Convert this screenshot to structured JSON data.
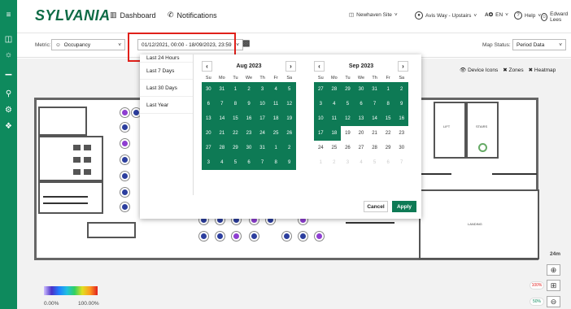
{
  "app": {
    "logo": "SYLVANIA"
  },
  "nav": {
    "dashboard": "Dashboard",
    "notifications": "Notifications"
  },
  "top_right": {
    "site": "Newhaven Site",
    "location": "Avis Way - Upstairs",
    "language": "EN",
    "help": "Help",
    "user": "Edward Lees"
  },
  "filters": {
    "metric_label": "Metric:",
    "metric_value": "Occupancy",
    "date_range": "01/12/2021, 00:00 - 18/09/2023, 23:59",
    "map_status_label": "Map Status:",
    "map_status_value": "Period Data"
  },
  "view_options": {
    "device_icons": "Device Icons",
    "zones": "Zones",
    "heatmap": "Heatmap"
  },
  "datepicker": {
    "presets": [
      "Last 24 Hours",
      "Last 7 Days",
      "Last 30 Days",
      "Last Year"
    ],
    "weekdays": [
      "Su",
      "Mo",
      "Tu",
      "We",
      "Th",
      "Fr",
      "Sa"
    ],
    "months": [
      {
        "title": "Aug 2023",
        "days": [
          {
            "d": "30",
            "s": "sel"
          },
          {
            "d": "31",
            "s": "sel"
          },
          {
            "d": "1",
            "s": "sel"
          },
          {
            "d": "2",
            "s": "sel"
          },
          {
            "d": "3",
            "s": "sel"
          },
          {
            "d": "4",
            "s": "sel"
          },
          {
            "d": "5",
            "s": "sel"
          },
          {
            "d": "6",
            "s": "sel"
          },
          {
            "d": "7",
            "s": "sel"
          },
          {
            "d": "8",
            "s": "sel"
          },
          {
            "d": "9",
            "s": "sel"
          },
          {
            "d": "10",
            "s": "sel"
          },
          {
            "d": "11",
            "s": "sel"
          },
          {
            "d": "12",
            "s": "sel"
          },
          {
            "d": "13",
            "s": "sel"
          },
          {
            "d": "14",
            "s": "sel"
          },
          {
            "d": "15",
            "s": "sel"
          },
          {
            "d": "16",
            "s": "sel"
          },
          {
            "d": "17",
            "s": "sel"
          },
          {
            "d": "18",
            "s": "sel"
          },
          {
            "d": "19",
            "s": "sel"
          },
          {
            "d": "20",
            "s": "sel"
          },
          {
            "d": "21",
            "s": "sel"
          },
          {
            "d": "22",
            "s": "sel"
          },
          {
            "d": "23",
            "s": "sel"
          },
          {
            "d": "24",
            "s": "sel"
          },
          {
            "d": "25",
            "s": "sel"
          },
          {
            "d": "26",
            "s": "sel"
          },
          {
            "d": "27",
            "s": "sel"
          },
          {
            "d": "28",
            "s": "sel"
          },
          {
            "d": "29",
            "s": "sel"
          },
          {
            "d": "30",
            "s": "sel"
          },
          {
            "d": "31",
            "s": "sel"
          },
          {
            "d": "1",
            "s": "sel"
          },
          {
            "d": "2",
            "s": "sel"
          },
          {
            "d": "3",
            "s": "sel"
          },
          {
            "d": "4",
            "s": "sel"
          },
          {
            "d": "5",
            "s": "sel"
          },
          {
            "d": "6",
            "s": "sel"
          },
          {
            "d": "7",
            "s": "sel"
          },
          {
            "d": "8",
            "s": "sel"
          },
          {
            "d": "9",
            "s": "sel"
          }
        ]
      },
      {
        "title": "Sep 2023",
        "days": [
          {
            "d": "27",
            "s": "sel"
          },
          {
            "d": "28",
            "s": "sel"
          },
          {
            "d": "29",
            "s": "sel"
          },
          {
            "d": "30",
            "s": "sel"
          },
          {
            "d": "31",
            "s": "sel"
          },
          {
            "d": "1",
            "s": "sel"
          },
          {
            "d": "2",
            "s": "sel"
          },
          {
            "d": "3",
            "s": "sel"
          },
          {
            "d": "4",
            "s": "sel"
          },
          {
            "d": "5",
            "s": "sel"
          },
          {
            "d": "6",
            "s": "sel"
          },
          {
            "d": "7",
            "s": "sel"
          },
          {
            "d": "8",
            "s": "sel"
          },
          {
            "d": "9",
            "s": "sel"
          },
          {
            "d": "10",
            "s": "sel"
          },
          {
            "d": "11",
            "s": "sel"
          },
          {
            "d": "12",
            "s": "sel"
          },
          {
            "d": "13",
            "s": "sel"
          },
          {
            "d": "14",
            "s": "sel"
          },
          {
            "d": "15",
            "s": "sel"
          },
          {
            "d": "16",
            "s": "sel"
          },
          {
            "d": "17",
            "s": "sel"
          },
          {
            "d": "18",
            "s": "sel"
          },
          {
            "d": "19",
            "s": ""
          },
          {
            "d": "20",
            "s": ""
          },
          {
            "d": "21",
            "s": ""
          },
          {
            "d": "22",
            "s": ""
          },
          {
            "d": "23",
            "s": ""
          },
          {
            "d": "24",
            "s": ""
          },
          {
            "d": "25",
            "s": ""
          },
          {
            "d": "26",
            "s": ""
          },
          {
            "d": "27",
            "s": ""
          },
          {
            "d": "28",
            "s": ""
          },
          {
            "d": "29",
            "s": ""
          },
          {
            "d": "30",
            "s": ""
          },
          {
            "d": "1",
            "s": "dim"
          },
          {
            "d": "2",
            "s": "dim"
          },
          {
            "d": "3",
            "s": "dim"
          },
          {
            "d": "4",
            "s": "dim"
          },
          {
            "d": "5",
            "s": "dim"
          },
          {
            "d": "6",
            "s": "dim"
          },
          {
            "d": "7",
            "s": "dim"
          }
        ]
      }
    ],
    "cancel": "Cancel",
    "apply": "Apply"
  },
  "map": {
    "scale": "24m",
    "room_label_1": "LANDING",
    "room_label_2": "LIFT",
    "room_label_3": "STAIRS"
  },
  "legend": {
    "min": "0.00%",
    "max": "100.00%"
  },
  "zoom_pills": {
    "top": "100%",
    "bottom": "50%"
  },
  "colors": {
    "brand_green": "#0e8a5d",
    "selected_day": "#0e7a55",
    "highlight": "#e0201a"
  }
}
